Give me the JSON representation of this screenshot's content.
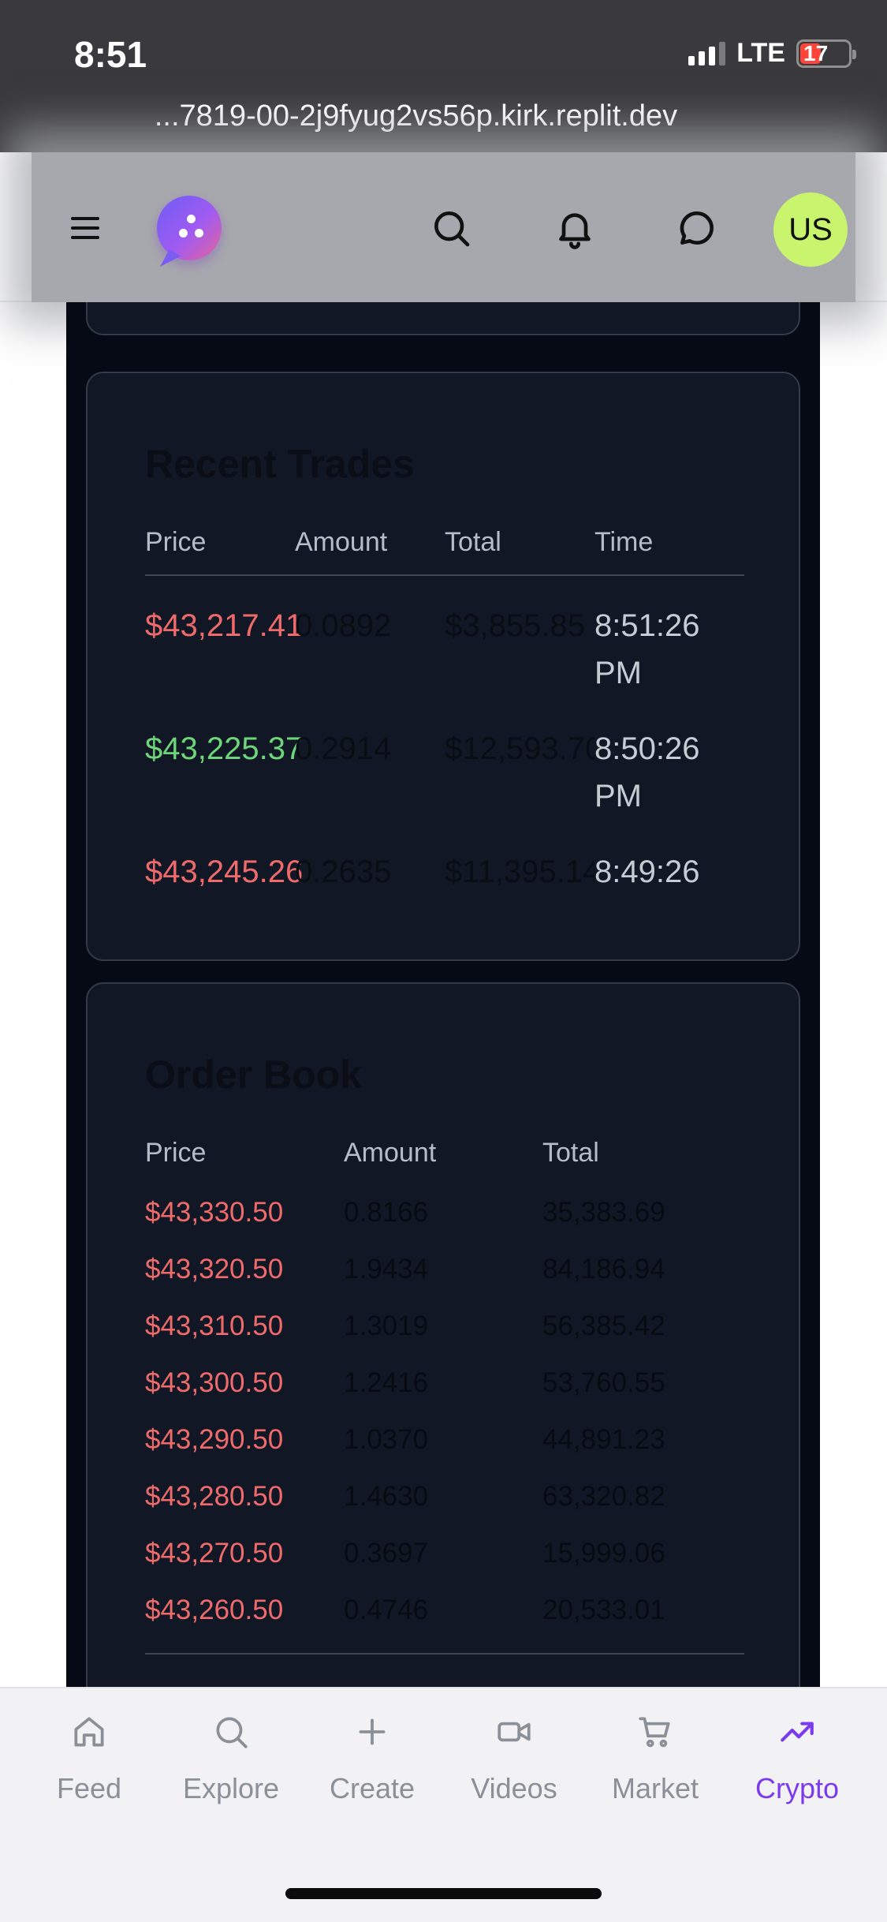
{
  "status_bar": {
    "time": "8:51",
    "network": "LTE",
    "battery": "17",
    "url": "...7819-00-2j9fyug2vs56p.kirk.replit.dev"
  },
  "header": {
    "menu_icon": "hamburger-icon",
    "logo_icon": "chat-bubble-logo",
    "icons": [
      "search-icon",
      "bell-icon",
      "message-icon"
    ],
    "avatar": "US",
    "avatar_color": "#c8f56d"
  },
  "recent_trades": {
    "title": "Recent Trades",
    "columns": [
      "Price",
      "Amount",
      "Total",
      "Time"
    ],
    "rows": [
      {
        "price": "$43,217.41",
        "amount": "0.0892",
        "total": "$3,855.85",
        "time": "8:51:26 PM",
        "side": "sell"
      },
      {
        "price": "$43,225.37",
        "amount": "0.2914",
        "total": "$12,593.70",
        "time": "8:50:26 PM",
        "side": "buy"
      },
      {
        "price": "$43,245.26",
        "amount": "0.2635",
        "total": "$11,395.14",
        "time": "8:49:26",
        "side": "sell"
      }
    ]
  },
  "order_book": {
    "title": "Order Book",
    "columns": [
      "Price",
      "Amount",
      "Total"
    ],
    "asks": [
      {
        "price": "$43,330.50",
        "amount": "0.8166",
        "total": "35,383.69"
      },
      {
        "price": "$43,320.50",
        "amount": "1.9434",
        "total": "84,186.94"
      },
      {
        "price": "$43,310.50",
        "amount": "1.3019",
        "total": "56,385.42"
      },
      {
        "price": "$43,300.50",
        "amount": "1.2416",
        "total": "53,760.55"
      },
      {
        "price": "$43,290.50",
        "amount": "1.0370",
        "total": "44,891.23"
      },
      {
        "price": "$43,280.50",
        "amount": "1.4630",
        "total": "63,320.82"
      },
      {
        "price": "$43,270.50",
        "amount": "0.3697",
        "total": "15,999.06"
      },
      {
        "price": "$43,260.50",
        "amount": "0.4746",
        "total": "20,533.01"
      }
    ]
  },
  "bottom_nav": {
    "active": "Crypto",
    "items": [
      {
        "label": "Feed",
        "icon": "home-icon"
      },
      {
        "label": "Explore",
        "icon": "search-icon"
      },
      {
        "label": "Create",
        "icon": "plus-icon"
      },
      {
        "label": "Videos",
        "icon": "video-icon"
      },
      {
        "label": "Market",
        "icon": "cart-icon"
      },
      {
        "label": "Crypto",
        "icon": "trending-up-icon"
      }
    ]
  },
  "colors": {
    "sell": "#ef6b6b",
    "buy": "#6dd67a",
    "accent": "#7c3aed",
    "panel": "#121725"
  }
}
